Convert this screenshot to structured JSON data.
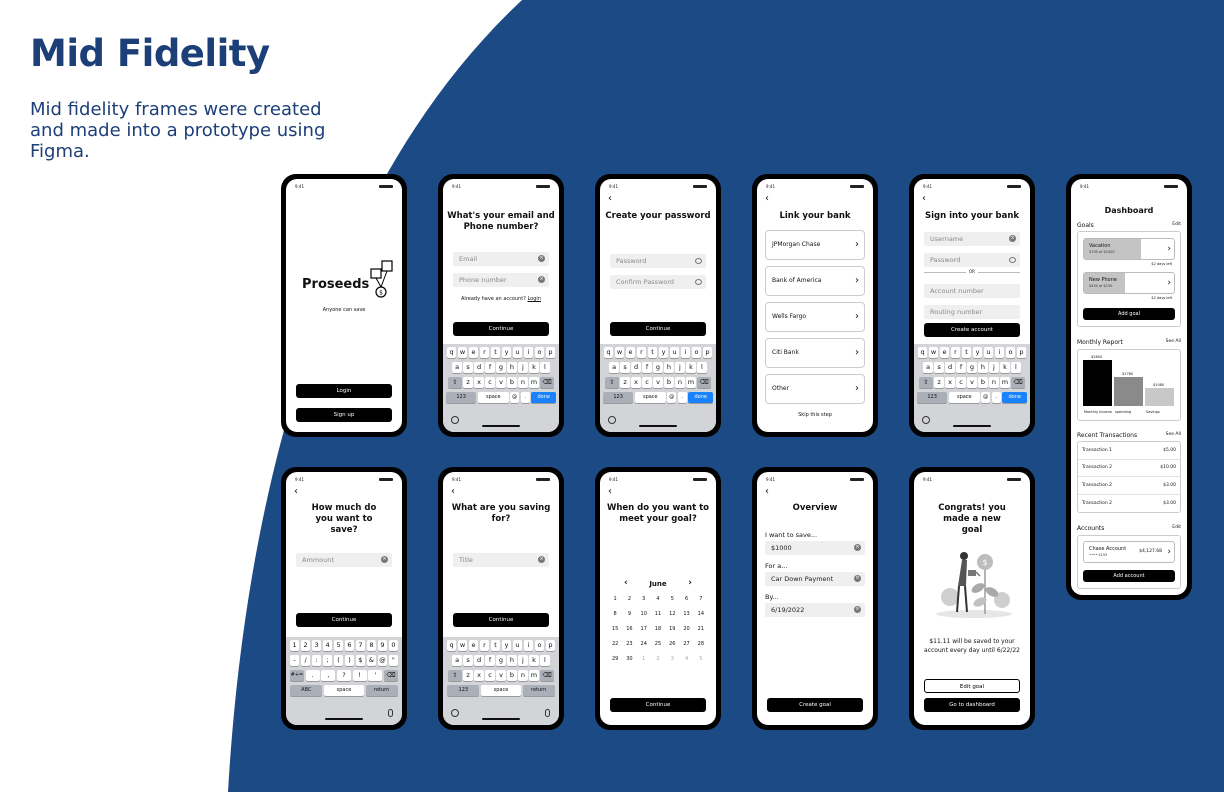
{
  "heading": "Mid Fidelity",
  "description": "Mid fidelity frames were created and made into a prototype using Figma.",
  "colors": {
    "brand": "#1c3f78",
    "accent": "#1a82fb"
  },
  "status_time": "9:41",
  "keyboard": {
    "row1": [
      "q",
      "w",
      "e",
      "r",
      "t",
      "y",
      "u",
      "i",
      "o",
      "p"
    ],
    "row2": [
      "a",
      "s",
      "d",
      "f",
      "g",
      "h",
      "j",
      "k",
      "l"
    ],
    "row3": [
      "z",
      "x",
      "c",
      "v",
      "b",
      "n",
      "m"
    ],
    "num_key": "123",
    "space": "space",
    "at": "@",
    "dot": ".",
    "done": "done",
    "return": "return",
    "num_row1": [
      "1",
      "2",
      "3",
      "4",
      "5",
      "6",
      "7",
      "8",
      "9",
      "0"
    ],
    "num_row2": [
      "-",
      "/",
      ":",
      ";",
      "(",
      ")",
      "$",
      "&",
      "@",
      "\""
    ],
    "num_row3": [
      ".",
      ",",
      "?",
      "!",
      "'"
    ],
    "sym_key": "#+=",
    "abc": "ABC"
  },
  "s1": {
    "brand": "Proseeds",
    "tagline": "Anyone can save",
    "login": "Login",
    "signup": "Sign up"
  },
  "s2": {
    "title": "What's your email and Phone number?",
    "email": "Email",
    "phone": "Phone number",
    "have_account": "Already have an account?",
    "login_link": "Login",
    "continue": "Continue"
  },
  "s3": {
    "title": "Create your password",
    "password": "Password",
    "confirm": "Confirm Password",
    "continue": "Continue"
  },
  "s4": {
    "title": "Link your bank",
    "banks": [
      "JPMorgan Chase",
      "Bank of America",
      "Wells Fargo",
      "Citi Bank",
      "Other"
    ],
    "skip": "Skip this step"
  },
  "s5": {
    "title": "Sign into your bank",
    "username": "Username",
    "password": "Password",
    "or": "OR",
    "account": "Account number",
    "routing": "Routing number",
    "create": "Create account"
  },
  "s6": {
    "title": "Dashboard",
    "goals": "Goals",
    "edit": "Edit",
    "goal_items": [
      {
        "name": "Vacation",
        "sub": "$700 of $1000",
        "days": "$2 days left",
        "progress": 0.7
      },
      {
        "name": "New Phone",
        "sub": "$450 of $150",
        "days": "$2 days left",
        "progress": 0.5
      }
    ],
    "add_goal": "Add goal",
    "report": "Monthly Report",
    "see_all": "See All",
    "chart_data": {
      "type": "bar",
      "categories": [
        "Monthly income",
        "spending",
        "Savings"
      ],
      "values": [
        2800,
        1780,
        1080
      ],
      "labels": [
        "$2800",
        "$1780",
        "$1080"
      ]
    },
    "recent": "Recent Transactions",
    "transactions": [
      {
        "name": "Transaction 1",
        "amount": "$5.00"
      },
      {
        "name": "Transaction 2",
        "amount": "$10.00"
      },
      {
        "name": "Transaction 2",
        "amount": "$3.00"
      },
      {
        "name": "Transaction 2",
        "amount": "$3.00"
      }
    ],
    "accounts": "Accounts",
    "acct_name": "Chase Account",
    "acct_mask": "•••• 4153",
    "acct_bal": "$4,127.68",
    "add_account": "Add account"
  },
  "s7": {
    "title": "How much do you want to save?",
    "amount": "Ammount",
    "continue": "Continue"
  },
  "s8": {
    "title": "What are you saving for?",
    "placeholder": "Title",
    "continue": "Continue"
  },
  "s9": {
    "title": "When do you want to meet your goal?",
    "month": "June",
    "weeks": [
      [
        "1",
        "2",
        "3",
        "4",
        "5",
        "6",
        "7"
      ],
      [
        "8",
        "9",
        "10",
        "11",
        "12",
        "13",
        "14"
      ],
      [
        "15",
        "16",
        "17",
        "18",
        "19",
        "20",
        "21"
      ],
      [
        "22",
        "23",
        "24",
        "25",
        "26",
        "27",
        "28"
      ],
      [
        "29",
        "30",
        "1",
        "2",
        "3",
        "4",
        "5"
      ]
    ],
    "continue": "Continue"
  },
  "s10": {
    "title": "Overview",
    "l1": "I want to save...",
    "v1": "$1000",
    "l2": "For a...",
    "v2": "Car Down Payment",
    "l3": "By...",
    "v3": "6/19/2022",
    "create": "Create goal"
  },
  "s11": {
    "title": "Congrats! you made a new goal",
    "message": "$11.11 will be saved to your account every day until 6/22/22",
    "edit": "Edit goal",
    "dashboard": "Go to dashboard"
  }
}
